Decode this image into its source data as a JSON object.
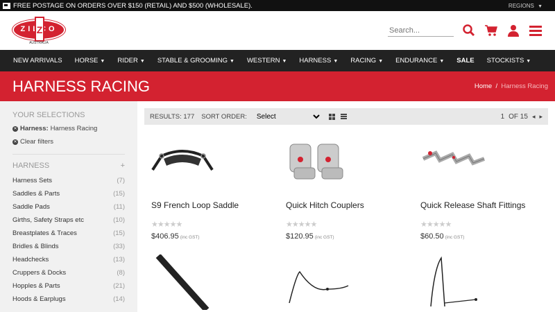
{
  "topbar": {
    "promo": "FREE POSTAGE ON ORDERS OVER $150 (RETAIL) AND $500 (WHOLESALE).",
    "regions": "REGIONS"
  },
  "logo": {
    "text": "ZILCO",
    "sub": "AUSTRALIA"
  },
  "search": {
    "placeholder": "Search..."
  },
  "nav": [
    {
      "label": "NEW ARRIVALS"
    },
    {
      "label": "HORSE"
    },
    {
      "label": "RIDER"
    },
    {
      "label": "STABLE & GROOMING"
    },
    {
      "label": "WESTERN"
    },
    {
      "label": "HARNESS"
    },
    {
      "label": "RACING"
    },
    {
      "label": "ENDURANCE"
    },
    {
      "label": "SALE"
    },
    {
      "label": "STOCKISTS"
    }
  ],
  "banner": {
    "title": "HARNESS RACING",
    "crumb_home": "Home",
    "crumb_sep": "/",
    "crumb_current": "Harness Racing"
  },
  "sidebar": {
    "selections_title": "YOUR SELECTIONS",
    "selection_key": "Harness:",
    "selection_value": "Harness Racing",
    "clear": "Clear filters",
    "harness_title": "HARNESS",
    "categories": [
      {
        "label": "Harness Sets",
        "count": "(7)"
      },
      {
        "label": "Saddles & Parts",
        "count": "(15)"
      },
      {
        "label": "Saddle Pads",
        "count": "(11)"
      },
      {
        "label": "Girths, Safety Straps etc",
        "count": "(10)"
      },
      {
        "label": "Breastplates & Traces",
        "count": "(15)"
      },
      {
        "label": "Bridles & Blinds",
        "count": "(33)"
      },
      {
        "label": "Headchecks",
        "count": "(13)"
      },
      {
        "label": "Cruppers & Docks",
        "count": "(8)"
      },
      {
        "label": "Hopples & Parts",
        "count": "(21)"
      },
      {
        "label": "Hoods & Earplugs",
        "count": "(14)"
      }
    ]
  },
  "sortbar": {
    "results": "RESULTS: 177",
    "sort_label": "SORT ORDER:",
    "sort_value": "Select",
    "page": "1",
    "of": "OF 15"
  },
  "products": [
    {
      "name": "S9 French Loop Saddle",
      "price": "$406.95",
      "gst": "(inc GST)"
    },
    {
      "name": "Quick Hitch Couplers",
      "price": "$120.95",
      "gst": "(inc GST)"
    },
    {
      "name": "Quick Release Shaft Fittings",
      "price": "$60.50",
      "gst": "(inc GST)"
    }
  ],
  "colors": {
    "brand": "#d32230",
    "nav": "#222222"
  }
}
